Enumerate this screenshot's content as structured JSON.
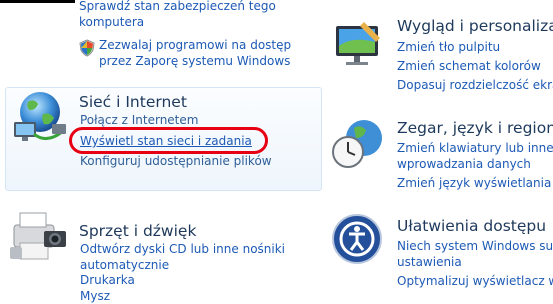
{
  "panel_left": {
    "system_security": {
      "links": [
        "Sprawdź stan zabezpieczeń tego",
        "komputera"
      ],
      "firewall_link": [
        "Zezwalaj programowi na dostęp",
        "przez Zaporę systemu Windows"
      ]
    },
    "network": {
      "title": "Sieć i Internet",
      "links": [
        "Połącz z Internetem",
        "Wyświetl stan sieci i zadania",
        "Konfiguruj udostępnianie plików"
      ]
    },
    "hardware": {
      "title": "Sprzęt i dźwięk",
      "links": [
        "Odtwórz dyski CD lub inne nośniki",
        "automatycznie",
        "Drukarka",
        "Mysz"
      ]
    }
  },
  "panel_right": {
    "appearance": {
      "title": "Wygląd i personaliza",
      "links": [
        "Zmień tło pulpitu",
        "Zmień schemat kolorów",
        "Dopasuj rozdzielczość ekra"
      ]
    },
    "clock": {
      "title": "Zegar, język i region",
      "links": [
        "Zmień klawiatury lub inne",
        "wprowadzania danych",
        "Zmień język wyświetlania"
      ]
    },
    "ease": {
      "title": "Ułatwienia dostępu",
      "links": [
        "Niech system Windows su",
        "ustawienia",
        "Optymalizuj wyświetlacz w"
      ]
    }
  },
  "colors": {
    "link": "#1d5ab5",
    "title": "#1e395b",
    "highlight": "#e60012"
  }
}
